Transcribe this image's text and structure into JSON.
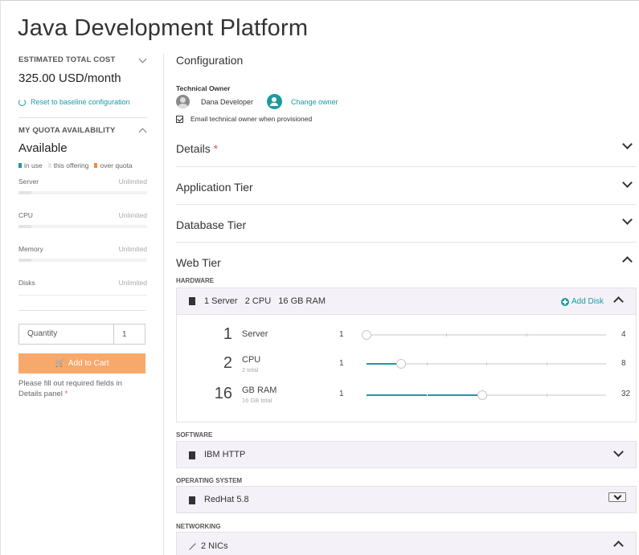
{
  "page_title": "Java Development Platform",
  "cost": {
    "label": "ESTIMATED TOTAL COST",
    "value": "325.00 USD/month",
    "reset_label": "Reset to baseline configuration"
  },
  "quota": {
    "label": "MY QUOTA AVAILABILITY",
    "status": "Available",
    "legend": [
      {
        "label": "in use",
        "color": "#1a9ba0"
      },
      {
        "label": "this offering",
        "color": "#e8e8e8"
      },
      {
        "label": "over quota",
        "color": "#f08a3c"
      }
    ],
    "rows": [
      {
        "label": "Server",
        "value": "Unlimited"
      },
      {
        "label": "CPU",
        "value": "Unlimited"
      },
      {
        "label": "Memory",
        "value": "Unlimited"
      },
      {
        "label": "Disks",
        "value": "Unlimited"
      }
    ]
  },
  "order": {
    "quantity_label": "Quantity",
    "quantity_value": "1",
    "add_to_cart": "Add to Cart",
    "message": "Please fill out required fields in Details panel",
    "required_mark": "*"
  },
  "configuration": {
    "title": "Configuration",
    "technical_owner_label": "Technical Owner",
    "owner_name": "Dana Developer",
    "change_owner": "Change owner",
    "email_label": "Email technical owner when provisioned",
    "email_checked": true
  },
  "sections": {
    "details": "Details",
    "details_required": "*",
    "application_tier": "Application Tier",
    "database_tier": "Database Tier",
    "web_tier": "Web Tier"
  },
  "hardware": {
    "label": "HARDWARE",
    "summary": "1 Server   2 CPU   16 GB RAM",
    "add_disk": "Add Disk",
    "resources": [
      {
        "value": "1",
        "unit": "Server",
        "sub": "",
        "min": "1",
        "max": "4",
        "level": 0.0
      },
      {
        "value": "2",
        "unit": "CPU",
        "sub": "2 total",
        "min": "1",
        "max": "8",
        "level": 0.1429
      },
      {
        "value": "16",
        "unit": "GB RAM",
        "sub": "16 GB total",
        "min": "1",
        "max": "32",
        "level": 0.4839
      }
    ]
  },
  "software": {
    "label": "SOFTWARE",
    "value": "IBM HTTP"
  },
  "operating_system": {
    "label": "OPERATING SYSTEM",
    "value": "RedHat 5.8"
  },
  "networking": {
    "label": "NETWORKING",
    "value": "2 NICs"
  },
  "colors": {
    "accent": "#1a9ba0",
    "cart_button": "#f7a86b",
    "required": "#e05a4e"
  }
}
